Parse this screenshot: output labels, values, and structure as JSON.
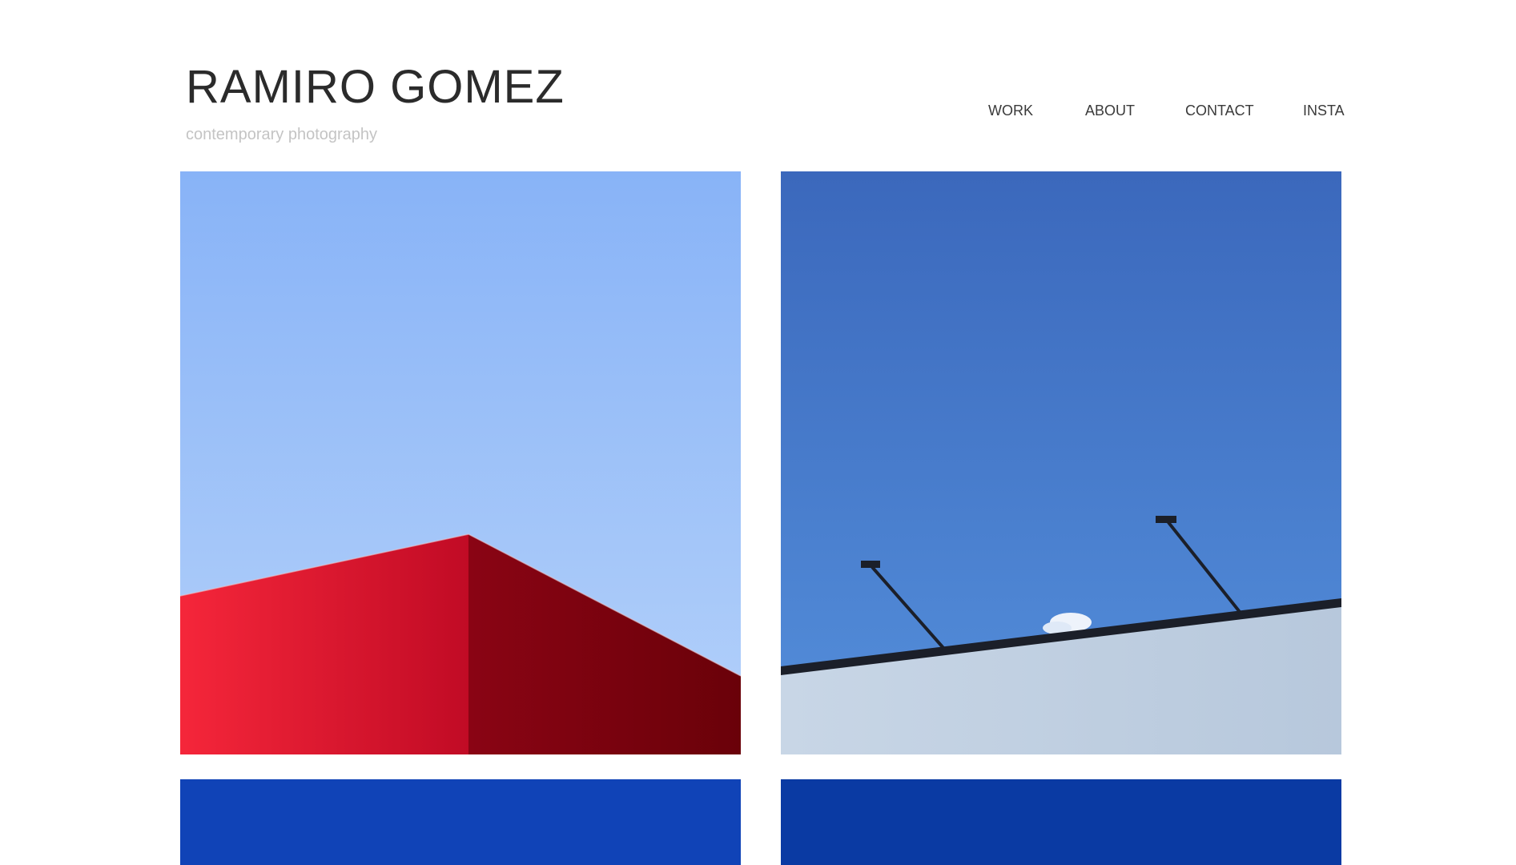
{
  "header": {
    "title": "RAMIRO GOMEZ",
    "tagline": "contemporary photography"
  },
  "nav": {
    "items": [
      {
        "label": "WORK"
      },
      {
        "label": "ABOUT"
      },
      {
        "label": "CONTACT"
      },
      {
        "label": "INSTA"
      }
    ]
  },
  "gallery": {
    "photos": [
      {
        "subject": "red-building-corner-against-sky"
      },
      {
        "subject": "rooftop-lamps-against-blue-sky"
      },
      {
        "subject": "deep-blue-wall"
      },
      {
        "subject": "deep-blue-sky"
      }
    ]
  },
  "colors": {
    "title": "#2b2b2b",
    "tagline": "#c4c4c4",
    "nav": "#3a3a3a"
  }
}
